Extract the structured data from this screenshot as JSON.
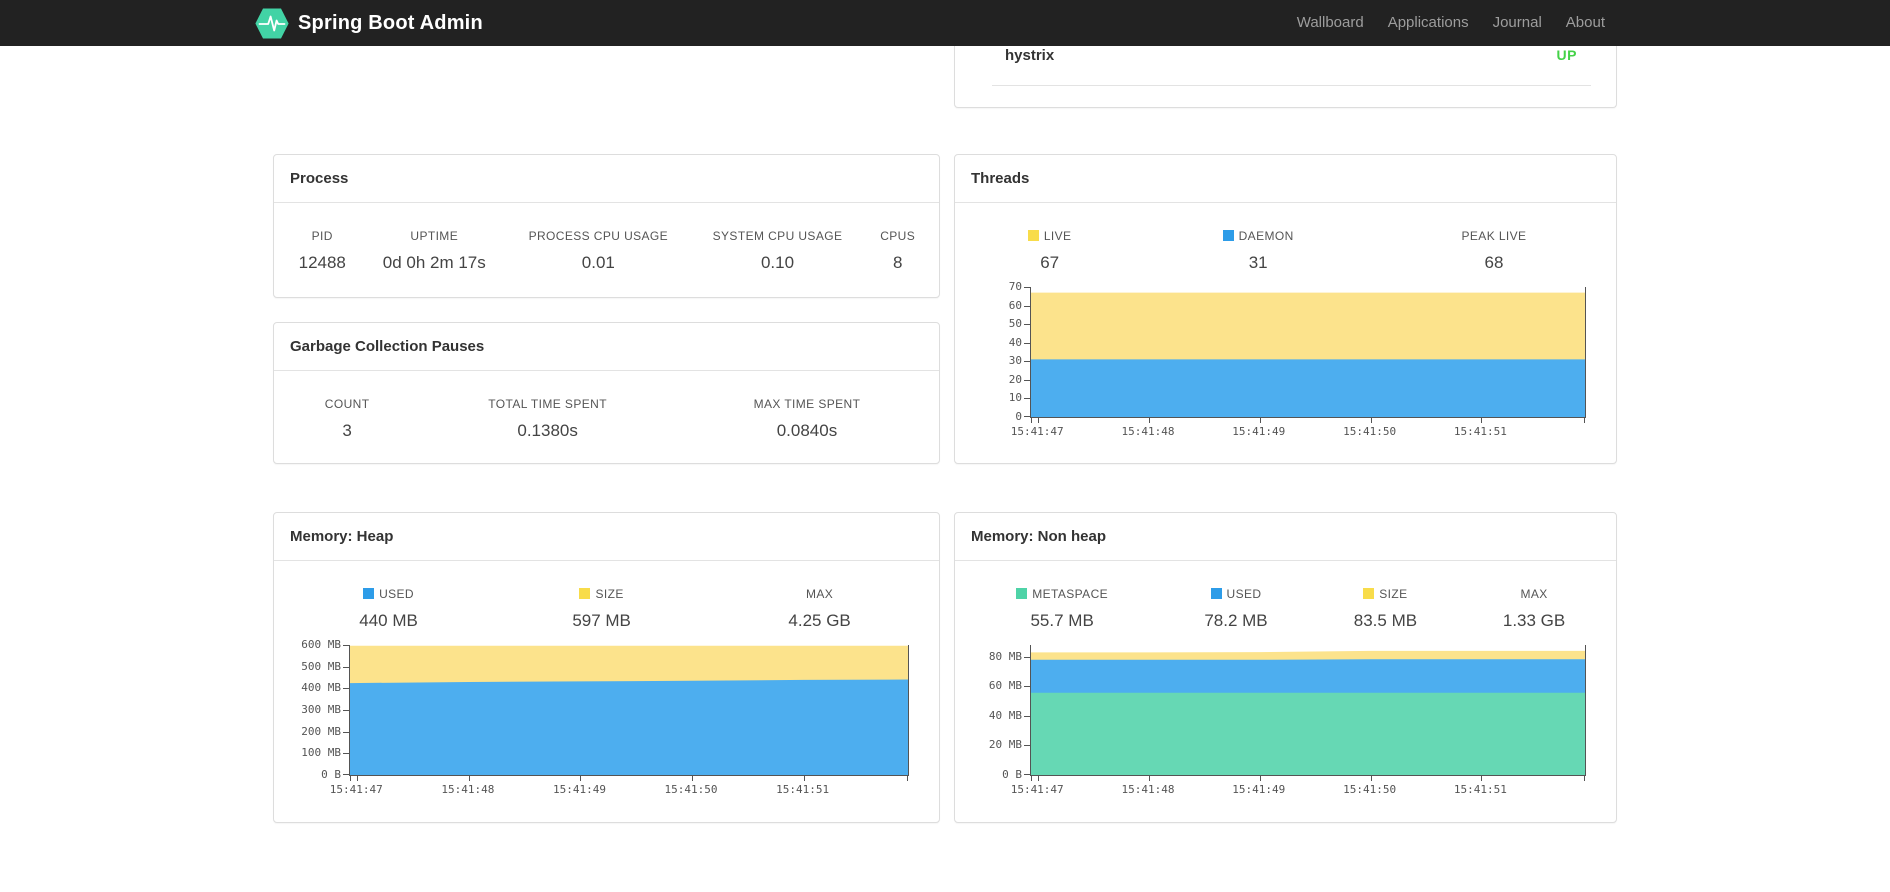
{
  "navbar": {
    "brand": "Spring Boot Admin",
    "logo_icon": "pulse-hexagon-icon",
    "links": [
      {
        "label": "Wallboard"
      },
      {
        "label": "Applications"
      },
      {
        "label": "Journal"
      },
      {
        "label": "About"
      }
    ]
  },
  "colors": {
    "navbar_bg": "#222222",
    "navbar_link": "#9d9d9d",
    "brand_green": "#42d3a5",
    "status_up": "#44d248",
    "card_border": "#dddddd",
    "axis": "#545454",
    "legend_yellow": "#f8dc4a",
    "legend_blue": "#2d9ce8",
    "legend_green": "#4ed3a7",
    "area_yellow": "#fce38c",
    "area_blue": "#4daeef",
    "area_green": "#66d8b4"
  },
  "health_card": {
    "rows": [
      {
        "name": "hystrix",
        "status": "UP"
      }
    ]
  },
  "process_card": {
    "title": "Process",
    "metrics": [
      {
        "label": "PID",
        "value": "12488"
      },
      {
        "label": "UPTIME",
        "value": "0d 0h 2m 17s"
      },
      {
        "label": "PROCESS CPU USAGE",
        "value": "0.01"
      },
      {
        "label": "SYSTEM CPU USAGE",
        "value": "0.10"
      },
      {
        "label": "CPUS",
        "value": "8"
      }
    ]
  },
  "gc_card": {
    "title": "Garbage Collection Pauses",
    "metrics": [
      {
        "label": "COUNT",
        "value": "3"
      },
      {
        "label": "TOTAL TIME SPENT",
        "value": "0.1380s"
      },
      {
        "label": "MAX TIME SPENT",
        "value": "0.0840s"
      }
    ]
  },
  "threads_card": {
    "title": "Threads",
    "metrics": [
      {
        "label": "LIVE",
        "value": "67",
        "color": "#f8dc4a"
      },
      {
        "label": "DAEMON",
        "value": "31",
        "color": "#2d9ce8"
      },
      {
        "label": "PEAK LIVE",
        "value": "68"
      }
    ]
  },
  "heap_card": {
    "title": "Memory: Heap",
    "metrics": [
      {
        "label": "USED",
        "value": "440 MB",
        "color": "#2d9ce8"
      },
      {
        "label": "SIZE",
        "value": "597 MB",
        "color": "#f8dc4a"
      },
      {
        "label": "MAX",
        "value": "4.25 GB"
      }
    ]
  },
  "nonheap_card": {
    "title": "Memory: Non heap",
    "metrics": [
      {
        "label": "METASPACE",
        "value": "55.7 MB",
        "color": "#4ed3a7"
      },
      {
        "label": "USED",
        "value": "78.2 MB",
        "color": "#2d9ce8"
      },
      {
        "label": "SIZE",
        "value": "83.5 MB",
        "color": "#f8dc4a"
      },
      {
        "label": "MAX",
        "value": "1.33 GB"
      }
    ]
  },
  "chart_data": [
    {
      "type": "area",
      "title": "Threads",
      "xlabel": "",
      "ylabel": "",
      "grid": false,
      "legend_position": "top",
      "ylim": [
        0,
        70
      ],
      "yticks": [
        {
          "value": 0,
          "label": "0"
        },
        {
          "value": 10,
          "label": "10"
        },
        {
          "value": 20,
          "label": "20"
        },
        {
          "value": 30,
          "label": "30"
        },
        {
          "value": 40,
          "label": "40"
        },
        {
          "value": 50,
          "label": "50"
        },
        {
          "value": 60,
          "label": "60"
        },
        {
          "value": 70,
          "label": "70"
        }
      ],
      "x_tick_labels": [
        "15:41:47",
        "15:41:48",
        "15:41:49",
        "15:41:50",
        "15:41:51"
      ],
      "x_tick_fracs": [
        0.013,
        0.213,
        0.413,
        0.613,
        0.813
      ],
      "edge_tick_fracs": [
        0,
        1
      ],
      "x_fracs": [
        0,
        0.213,
        0.413,
        0.613,
        0.813,
        1
      ],
      "series": [
        {
          "name": "LIVE",
          "area_color": "#fce38c",
          "legend_color": "#f8dc4a",
          "values": [
            67,
            67,
            67,
            67,
            67,
            67
          ]
        },
        {
          "name": "DAEMON",
          "area_color": "#4daeef",
          "legend_color": "#2d9ce8",
          "values": [
            31,
            31,
            31,
            31,
            31,
            31
          ]
        }
      ]
    },
    {
      "type": "area",
      "title": "Memory: Heap (MB)",
      "xlabel": "",
      "ylabel": "",
      "grid": false,
      "legend_position": "top",
      "ylim": [
        0,
        600
      ],
      "yticks": [
        {
          "value": 0,
          "label": "0 B"
        },
        {
          "value": 100,
          "label": "100 MB"
        },
        {
          "value": 200,
          "label": "200 MB"
        },
        {
          "value": 300,
          "label": "300 MB"
        },
        {
          "value": 400,
          "label": "400 MB"
        },
        {
          "value": 500,
          "label": "500 MB"
        },
        {
          "value": 600,
          "label": "600 MB"
        }
      ],
      "x_tick_labels": [
        "15:41:47",
        "15:41:48",
        "15:41:49",
        "15:41:50",
        "15:41:51"
      ],
      "x_tick_fracs": [
        0.013,
        0.213,
        0.413,
        0.613,
        0.813
      ],
      "edge_tick_fracs": [
        0,
        1
      ],
      "x_fracs": [
        0,
        0.213,
        0.413,
        0.613,
        0.813,
        1
      ],
      "series": [
        {
          "name": "SIZE",
          "area_color": "#fce38c",
          "legend_color": "#f8dc4a",
          "values": [
            597,
            597,
            597,
            597,
            597,
            597
          ]
        },
        {
          "name": "USED",
          "area_color": "#4daeef",
          "legend_color": "#2d9ce8",
          "values": [
            424,
            429,
            432,
            435,
            439,
            441
          ]
        }
      ]
    },
    {
      "type": "area",
      "title": "Memory: Non heap (MB)",
      "xlabel": "",
      "ylabel": "",
      "grid": false,
      "legend_position": "top",
      "ylim": [
        0,
        88
      ],
      "yticks": [
        {
          "value": 0,
          "label": "0 B"
        },
        {
          "value": 20,
          "label": "20 MB"
        },
        {
          "value": 40,
          "label": "40 MB"
        },
        {
          "value": 60,
          "label": "60 MB"
        },
        {
          "value": 80,
          "label": "80 MB"
        }
      ],
      "x_tick_labels": [
        "15:41:47",
        "15:41:48",
        "15:41:49",
        "15:41:50",
        "15:41:51"
      ],
      "x_tick_fracs": [
        0.013,
        0.213,
        0.413,
        0.613,
        0.813
      ],
      "edge_tick_fracs": [
        0,
        1
      ],
      "x_fracs": [
        0,
        0.213,
        0.413,
        0.613,
        0.813,
        1
      ],
      "series": [
        {
          "name": "SIZE",
          "area_color": "#fce38c",
          "legend_color": "#f8dc4a",
          "values": [
            83,
            83,
            83.2,
            84,
            84,
            84
          ]
        },
        {
          "name": "USED",
          "area_color": "#4daeef",
          "legend_color": "#2d9ce8",
          "values": [
            78,
            78,
            78,
            78.3,
            78.3,
            78.4
          ]
        },
        {
          "name": "METASPACE",
          "area_color": "#66d8b4",
          "legend_color": "#4ed3a7",
          "values": [
            55.7,
            55.7,
            55.7,
            55.7,
            55.7,
            55.7
          ]
        }
      ]
    }
  ]
}
